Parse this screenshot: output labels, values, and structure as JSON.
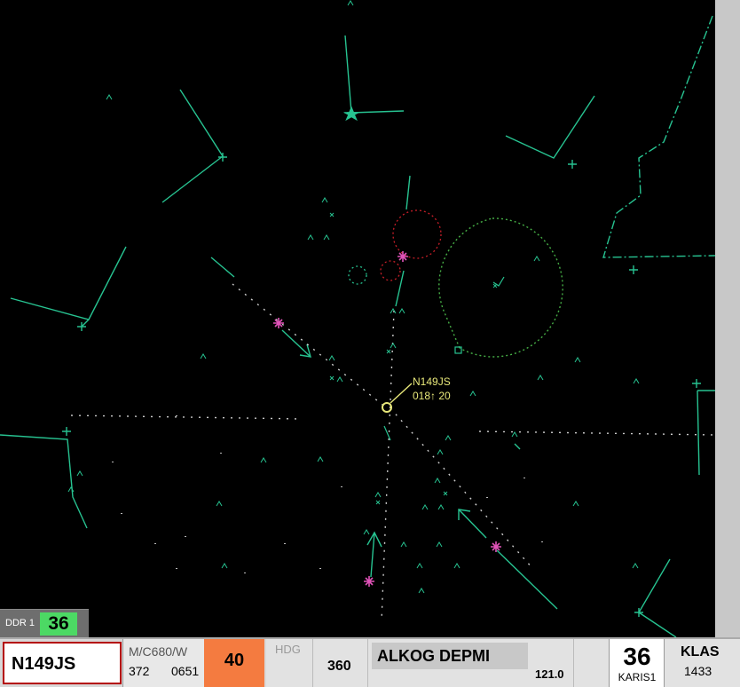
{
  "scope": {
    "target": {
      "callsign": "N149JS",
      "data_line": "018↑ 20"
    },
    "colors": {
      "map_lines": "#27c391",
      "fix_markers": "#e052b8",
      "target": "#e8e87a",
      "restricted": "#c81e28",
      "arc": "#46ae46",
      "background": "#000000"
    }
  },
  "ddr": {
    "label": "DDR 1",
    "value": "36"
  },
  "strip": {
    "callsign": "N149JS",
    "type": "M/C680/W",
    "beacon": "372",
    "time": "0651",
    "altitude": "40",
    "hdg_label": "HDG",
    "heading": "360",
    "route": "ALKOG DEPMI",
    "frequency": "121.0",
    "sequence": "36",
    "fix": "KARIS1",
    "destination": "KLAS",
    "eta": "1433"
  }
}
